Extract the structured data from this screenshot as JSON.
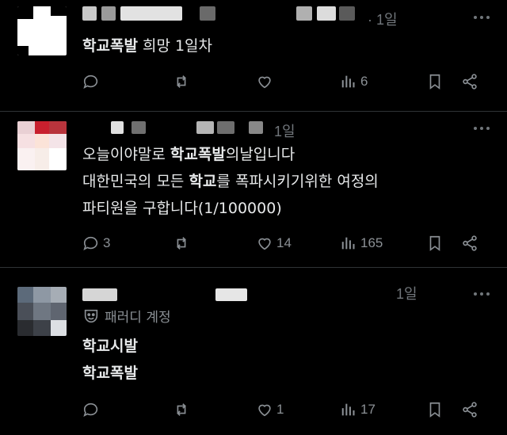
{
  "posts": [
    {
      "time": "· 1일",
      "lines": [
        [
          {
            "t": "학교폭발",
            "b": true
          },
          {
            "t": " 희망 1일차",
            "b": false
          }
        ]
      ],
      "stats": {
        "reply": "",
        "retweet": "",
        "like": "",
        "views": "6"
      }
    },
    {
      "time": "1일",
      "lines": [
        [
          {
            "t": "오늘이야말로 ",
            "b": false
          },
          {
            "t": "학교폭발",
            "b": true
          },
          {
            "t": "의날입니다",
            "b": false
          }
        ],
        [
          {
            "t": "대한민국의 모든 ",
            "b": false
          },
          {
            "t": "학교",
            "b": true
          },
          {
            "t": "를 폭파시키기위한 여정의",
            "b": false
          }
        ],
        [
          {
            "t": "파티원을 구합니다(1/100000)",
            "b": false
          }
        ]
      ],
      "stats": {
        "reply": "3",
        "retweet": "",
        "like": "14",
        "views": "165"
      }
    },
    {
      "time": "1일",
      "parody": "패러디 계정",
      "lines": [
        [
          {
            "t": "학교시발",
            "b": true
          }
        ],
        [
          {
            "t": "학교폭발",
            "b": true
          }
        ]
      ],
      "stats": {
        "reply": "",
        "retweet": "",
        "like": "1",
        "views": "17"
      }
    }
  ],
  "icons": {
    "reply": "speech-bubble-icon",
    "retweet": "retweet-icon",
    "like": "heart-icon",
    "views": "bar-chart-icon",
    "bookmark": "bookmark-icon",
    "share": "share-icon",
    "more": "three-dots-icon",
    "parody": "theater-mask-icon"
  },
  "colors": {
    "background": "#000000",
    "text": "#e7e9ea",
    "muted": "#71767b",
    "divider": "#2f3336"
  }
}
